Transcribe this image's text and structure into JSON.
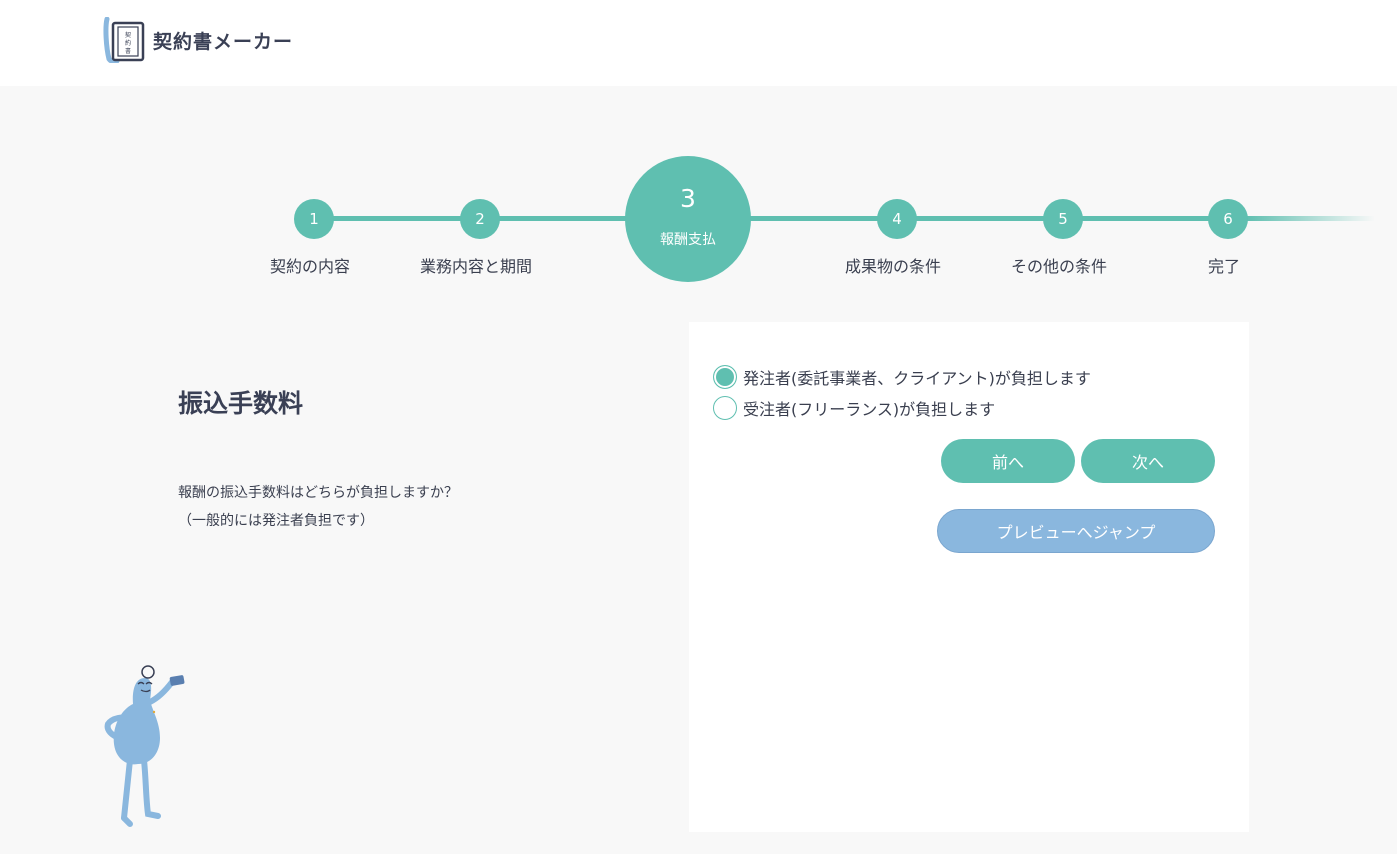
{
  "header": {
    "app_title": "契約書メーカー",
    "logo_icon": "contract-book-icon"
  },
  "stepper": {
    "steps": [
      {
        "number": "1",
        "label": "契約の内容"
      },
      {
        "number": "2",
        "label": "業務内容と期間"
      },
      {
        "number": "3",
        "label": "報酬支払"
      },
      {
        "number": "4",
        "label": "成果物の条件"
      },
      {
        "number": "5",
        "label": "その他の条件"
      },
      {
        "number": "6",
        "label": "完了"
      }
    ],
    "current": "3",
    "accent_color": "#5fbfb0"
  },
  "main": {
    "title": "振込手数料",
    "question_line1": "報酬の振込手数料はどちらが負担しますか？",
    "question_line2": "（一般的には発注者負担です）"
  },
  "form": {
    "options": [
      {
        "label": "発注者(委託事業者、クライアント)が負担します",
        "selected": true
      },
      {
        "label": "受注者(フリーランス)が負担します",
        "selected": false
      }
    ],
    "prev_label": "前へ",
    "next_label": "次へ",
    "preview_label": "プレビューへジャンプ"
  },
  "colors": {
    "teal": "#5fbfb0",
    "preview_blue": "#8ab7de",
    "mascot_blue": "#8ab7de"
  }
}
